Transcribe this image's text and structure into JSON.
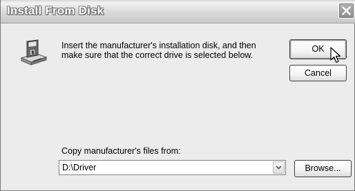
{
  "window": {
    "title": "Install From Disk"
  },
  "message": {
    "line1": "Insert the manufacturer's installation disk, and then",
    "line2": "make sure that the correct drive is selected below."
  },
  "buttons": {
    "ok_label": "OK",
    "cancel_label": "Cancel",
    "browse_label": "Browse..."
  },
  "copy_from": {
    "label": "Copy manufacturer's files from:",
    "value": "D:\\Driver"
  },
  "icons": {
    "disk": "floppy-drive-install-icon",
    "close": "close-icon",
    "dropdown": "chevron-down-icon",
    "cursor": "mouse-pointer-icon"
  }
}
